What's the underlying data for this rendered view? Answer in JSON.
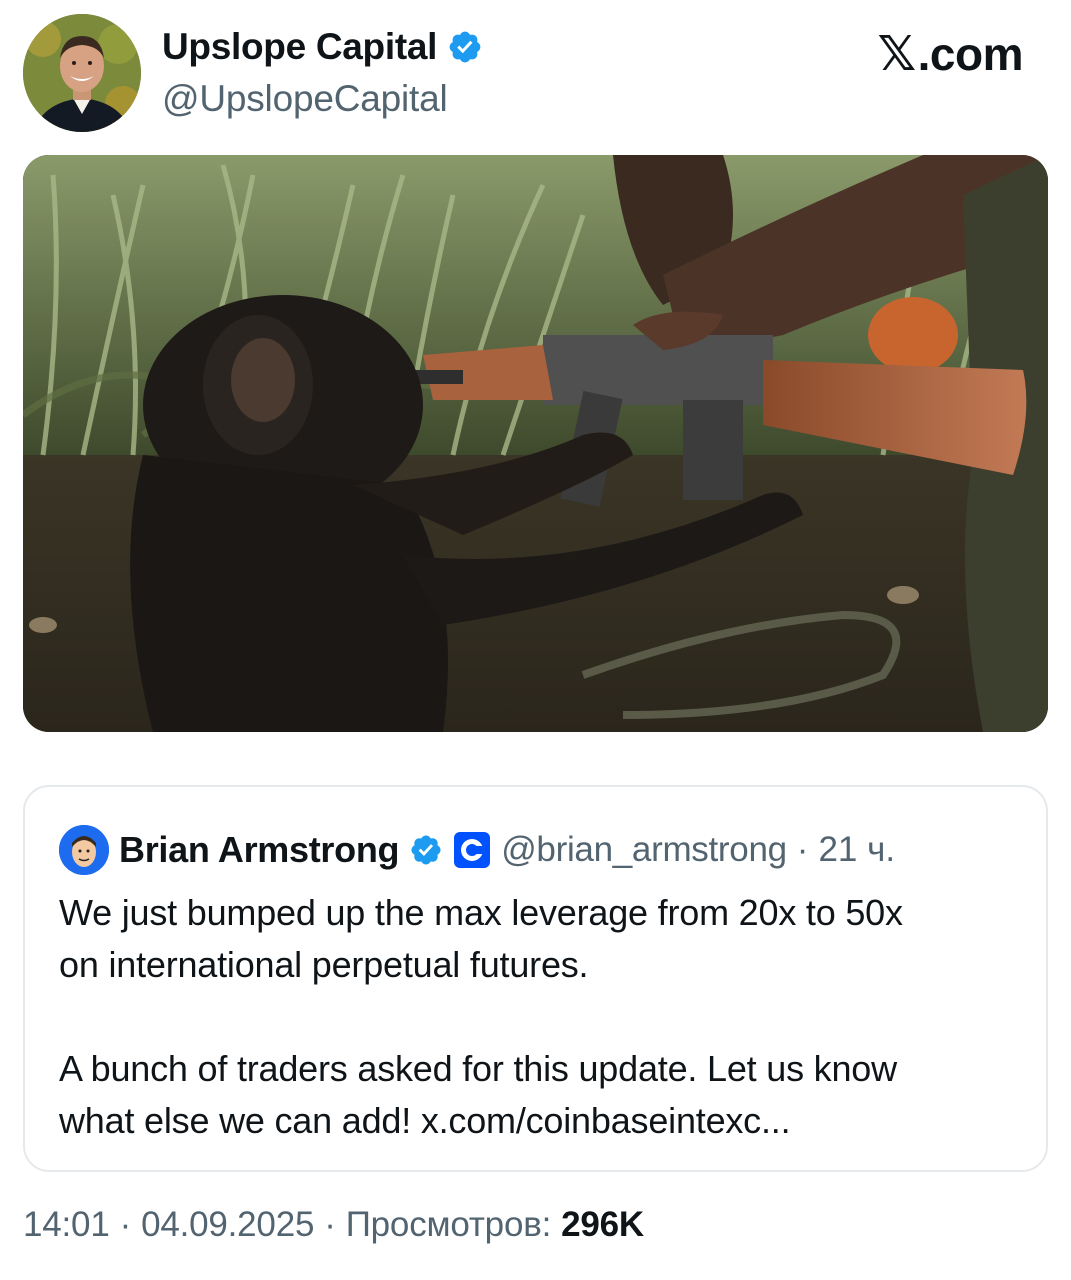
{
  "author": {
    "name": "Upslope Capital",
    "handle": "@UpslopeCapital",
    "verified_icon": "verified-badge-icon"
  },
  "site": {
    "label": ".com",
    "logo": "x-logo-icon"
  },
  "quoted_tweet": {
    "author_name": "Brian Armstrong",
    "handle": "@brian_armstrong",
    "separator": "·",
    "time": "21 ч.",
    "verified_icon": "verified-badge-icon",
    "org_icon": "coinbase-icon",
    "line1": "We just bumped up the max leverage from 20x to 50x",
    "line2": "on international perpetual futures.",
    "line3": "A bunch of traders asked for this update. Let us know",
    "line4": "what else we can add! x.com/coinbaseintexc..."
  },
  "meta": {
    "time": "14:01",
    "sep1": "·",
    "date": "04.09.2025",
    "sep2": "·",
    "views_label": "Просмотров:",
    "views_count": "296K"
  },
  "colors": {
    "text_primary": "#0f1419",
    "text_secondary": "#536471",
    "verified_blue": "#1d9bf0",
    "coinbase_blue": "#0052ff",
    "border": "#e6e9ec"
  }
}
